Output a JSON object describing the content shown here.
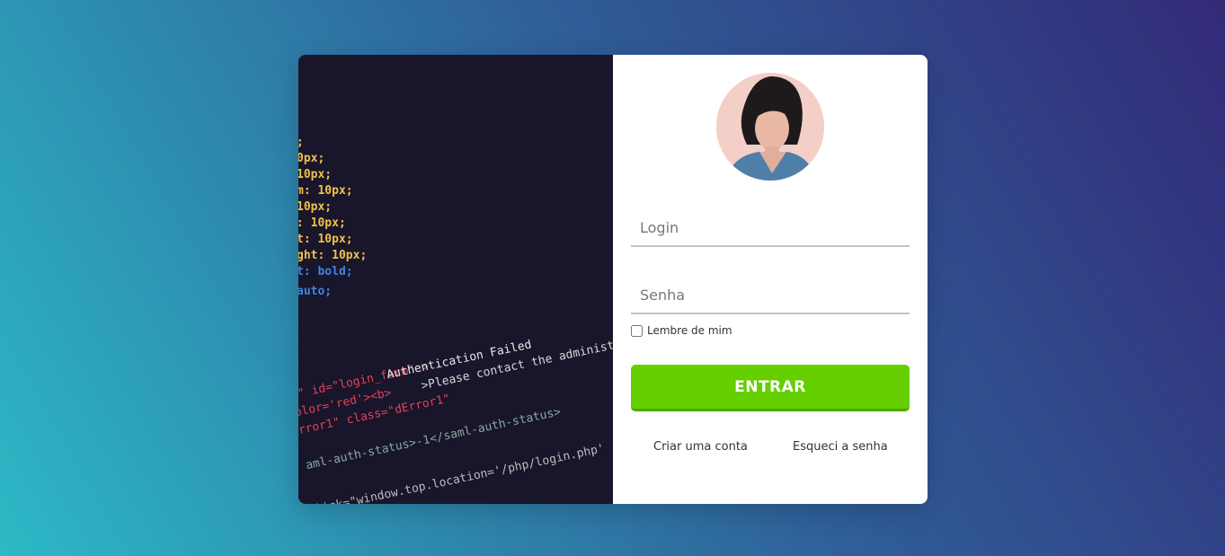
{
  "login_form": {
    "login_placeholder": "Login",
    "password_placeholder": "Senha",
    "remember_label": "Lembre de mim",
    "submit_label": "ENTRAR",
    "create_account_link": "Criar uma conta",
    "forgot_password_link": "Esqueci a senha"
  },
  "code_image": {
    "css_lines": [
      ";",
      "0px;",
      "10px;",
      "m: 10px;",
      " 10px;",
      ": 10px;",
      "t: 10px;",
      "ght: 10px;",
      "t: bold;",
      " auto;"
    ],
    "html_line_1": "n\" id=\"login_form\" >",
    "html_line_1b": "Authentication Failed",
    "html_line_2": "olor='red'><b>",
    "html_line_2b": ">Please contact the administ",
    "html_line_3": "rror1\" class=\"dError1\"",
    "html_line_4": "aml-auth-status>-1</saml-auth-status>",
    "html_line_5": "lick=\"window.top.location='/php/login.php'"
  },
  "colors": {
    "accent": "#65cf00",
    "code_background": "#19152a"
  }
}
